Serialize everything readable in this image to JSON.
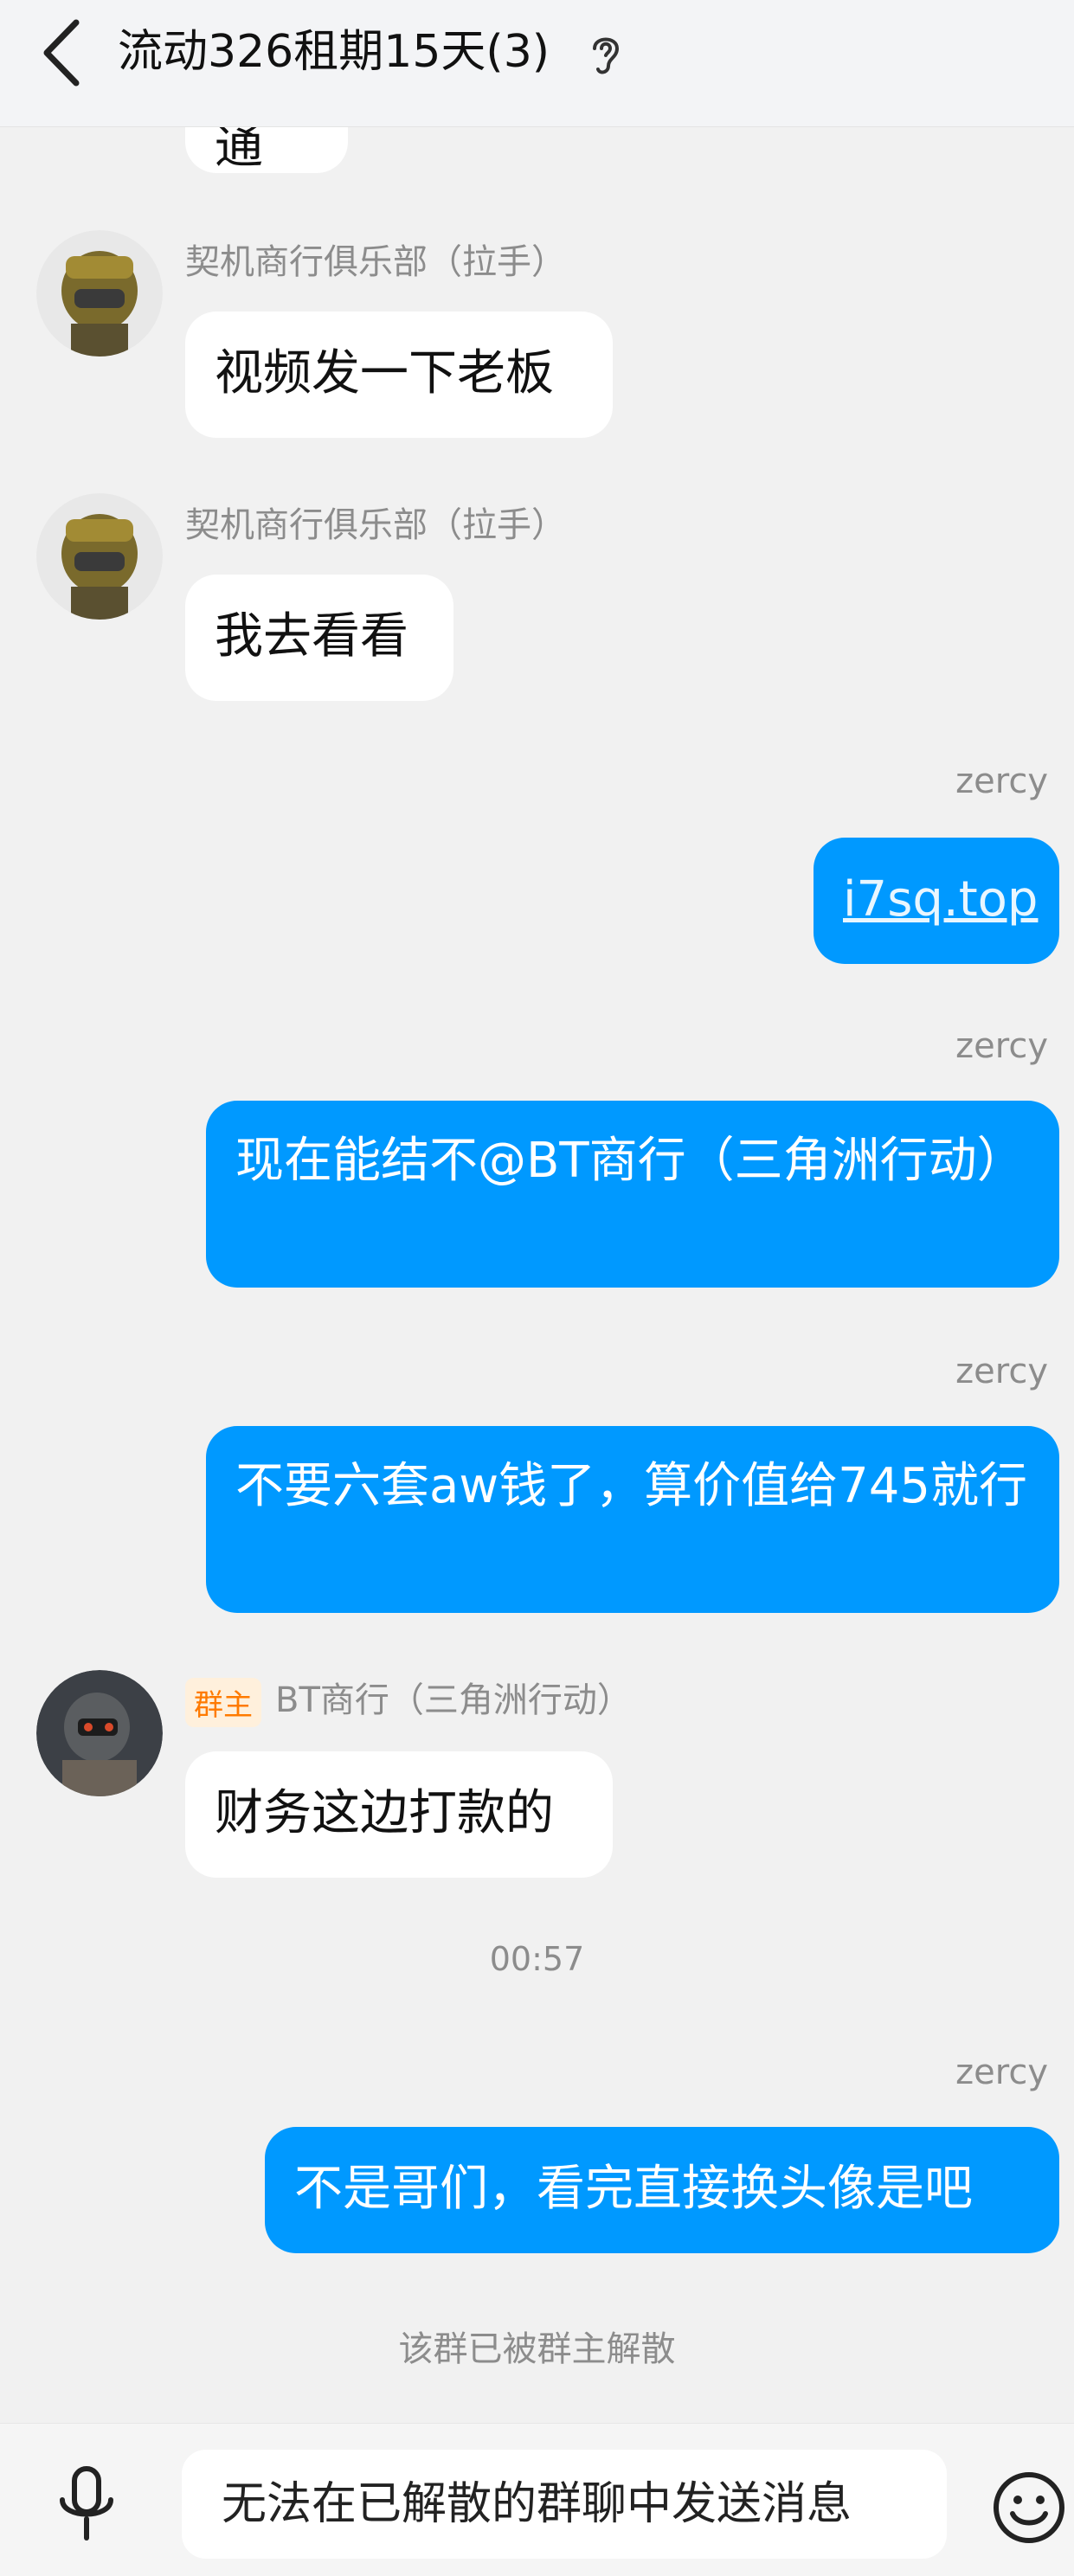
{
  "header": {
    "title": "流动326租期15天(3)"
  },
  "messages": {
    "m0": {
      "text": "一个通"
    },
    "m1": {
      "sender": "契机商行俱乐部（拉手）",
      "text": "视频发一下老板"
    },
    "m2": {
      "sender": "契机商行俱乐部（拉手）",
      "text": "我去看看"
    },
    "m3": {
      "sender": "zercy",
      "text": "i7sq.top"
    },
    "m4": {
      "sender": "zercy",
      "text": "现在能结不@BT商行（三角洲行动）"
    },
    "m5": {
      "sender": "zercy",
      "text": "不要六套aw钱了，算价值给745就行"
    },
    "m6": {
      "badge": "群主",
      "sender": "BT商行（三角洲行动）",
      "text": "财务这边打款的"
    },
    "time": "00:57",
    "m7": {
      "sender": "zercy",
      "text": "不是哥们，看完直接换头像是吧"
    },
    "system": "该群已被群主解散"
  },
  "input": {
    "text": "无法在已解散的群聊中发送消息"
  },
  "icons": [
    "back-arrow-icon",
    "ear-icon",
    "microphone-icon",
    "emoji-icon"
  ],
  "colors": {
    "outgoing_bubble": "#0099ff",
    "incoming_bubble": "#ffffff",
    "owner_badge": "#ff7a00"
  }
}
